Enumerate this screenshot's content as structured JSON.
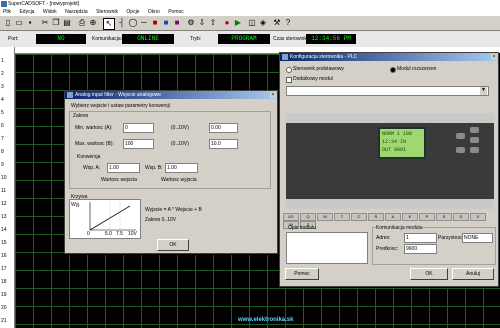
{
  "app": {
    "title": "SuperCADSOFT - [nowyprojekt]"
  },
  "menu": [
    "Plik",
    "Edycja",
    "Widok",
    "Narzędzia",
    "Sterownik",
    "Opcje",
    "Okno",
    "Pomoc"
  ],
  "status": {
    "port_label": "Port:",
    "port_value": "NO",
    "conn_label": "Komunikacja:",
    "conn_value": "ONLINE",
    "mode_label": "Tryb:",
    "mode_value": "PROGRAM",
    "clock_label": "Czas sterownika:",
    "clock_value": "12:34:56 PM"
  },
  "ruler_rows": [
    "1",
    "2",
    "3",
    "4",
    "5",
    "6",
    "7",
    "8",
    "9",
    "10",
    "11",
    "12",
    "13",
    "14",
    "15",
    "16",
    "17",
    "18",
    "19",
    "20",
    "21",
    "22"
  ],
  "dlg_analog": {
    "title": "Analog input filter - Wejscie analogowe",
    "desc": "Wybierz wejscie i ustaw parametry konwersji",
    "range_label": "Zakres",
    "min_label": "Min. wartosc (A):",
    "min_value": "0",
    "min_unit_label": "(0..10V)",
    "min_unit_value": "0.00",
    "max_label": "Max. wartosc (B):",
    "max_value": "100",
    "max_unit_label": "(0..10V)",
    "max_unit_value": "10.0",
    "conv_label": "Konwersja",
    "ax_label": "Wsp. A:",
    "ax_value": "1.00",
    "bx_label": "Wsp. B:",
    "bx_value": "1.00",
    "note1": "Wartosc wejscia",
    "note2": "Wartosc wyjscia",
    "graph_title": "Krzywa",
    "graph_y": "Wyj.",
    "graph_x": [
      "0",
      "5.0",
      "7.5",
      "10V"
    ],
    "info1": "Wyjscie = A * Wejscie + B",
    "info2": "Zakres 0..10V",
    "ok_label": "OK"
  },
  "dlg_plc": {
    "title": "Konfiguracja sterownika - PLC",
    "opt1": "Sterownik podstawowy",
    "opt2": "Modul rozszerzen",
    "opt3": "Dodatkowy modul",
    "select_value": "",
    "lcd": [
      "NORM 1 100",
      "12:34 IN",
      "OUT 0001"
    ],
    "tabs": [
      "I/O",
      "Q",
      "M",
      "T",
      "C",
      "R",
      "A",
      "K",
      "P",
      "S",
      "D",
      "X",
      "W",
      "Z"
    ],
    "comment_label": "Opis modulu",
    "comm_label": "Komunikacja modulu",
    "addr_label": "Adres:",
    "addr_value": "1",
    "baud_label": "Predkosc:",
    "baud_value": "9600",
    "par_label": "Parzystosc:",
    "par_value": "NONE",
    "help_label": "Pomoc",
    "ok_label": "OK",
    "cancel_label": "Anuluj"
  },
  "watermark": "www.elektronika.sk"
}
